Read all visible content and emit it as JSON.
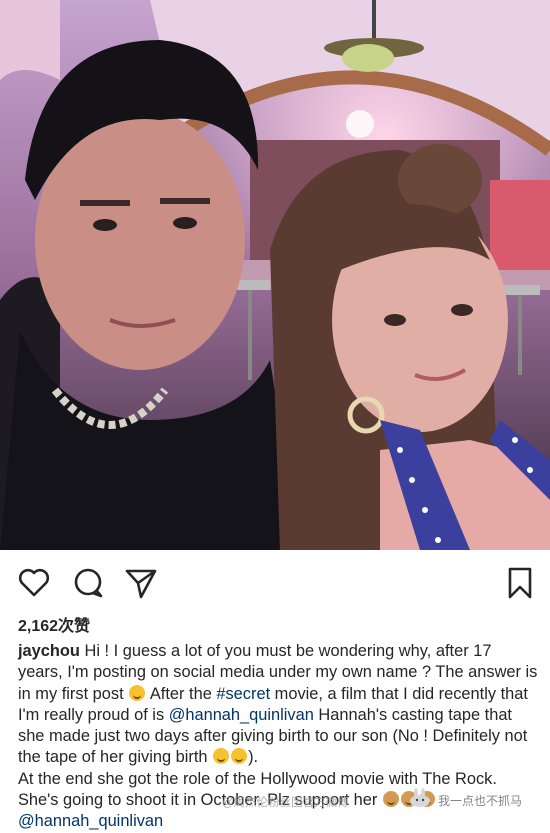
{
  "post": {
    "likes_label": "2,162次赞",
    "caption": {
      "username": "jaychou",
      "line1": " Hi ! I guess a lot of you must be wondering why, after 17 years, I'm posting on social media under my own name ? The answer is in my first post ",
      "line2": " After the ",
      "hashtag": "#secret",
      "line3": " movie, a film that I did recently that I'm really proud of is ",
      "mention1": "@hannah_quinlivan",
      "line4": " Hannah's casting tape that she made just two days after giving birth to our son (No ! Definitely not the tape of her giving birth ",
      "line5": ").",
      "line6": "At the end she got the role of the Hollywood movie with The Rock. She's going to shoot it in October. Plz support her ",
      "mention2": "@hannah_quinlivan"
    }
  },
  "icons": {
    "like": "heart-icon",
    "comment": "comment-icon",
    "share": "send-icon",
    "save": "bookmark-icon"
  },
  "watermarks": {
    "weibo": "@周杰伦粉丝团官方微博",
    "account": "我一点也不抓马"
  }
}
